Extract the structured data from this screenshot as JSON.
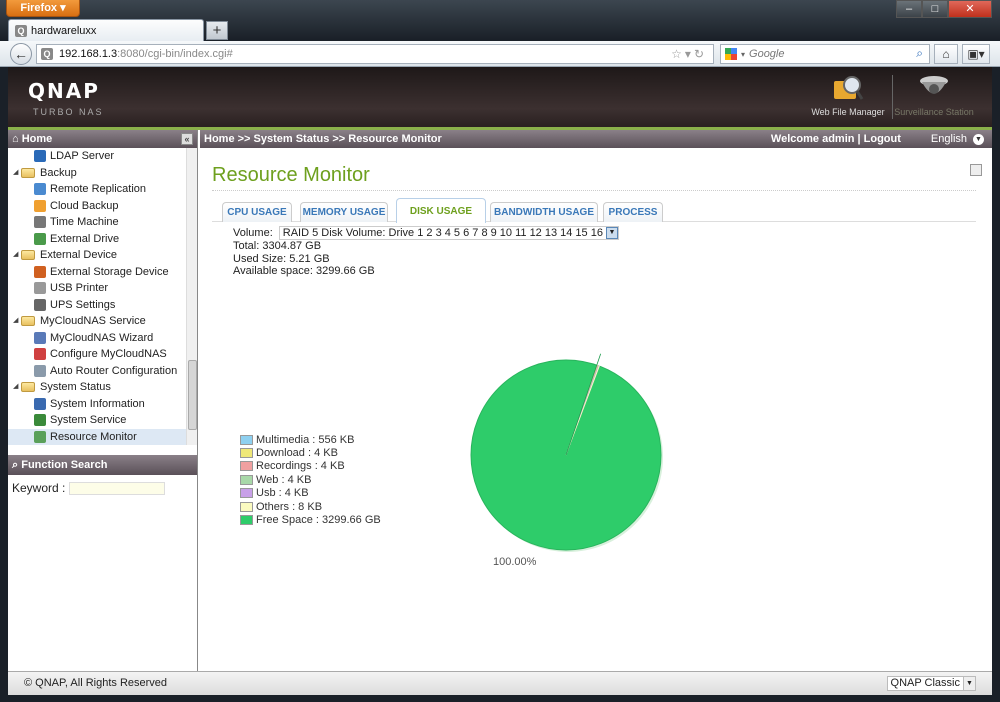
{
  "browser": {
    "app_button": "Firefox",
    "tab_title": "hardwareluxx",
    "new_tab": "+",
    "url_host": "192.168.1.3",
    "url_rest": ":8080/cgi-bin/index.cgi#",
    "search_placeholder": "Google",
    "window_controls": [
      "–",
      "□",
      "✕"
    ]
  },
  "header": {
    "logo": "QNAP",
    "subtitle": "TURBO NAS",
    "apps": [
      {
        "label": "Web File Manager",
        "icon": "folder-magnifier-icon"
      },
      {
        "label": "Surveillance Station",
        "icon": "camera-dome-icon"
      }
    ]
  },
  "sidebar": {
    "home_label": "Home",
    "tree": [
      {
        "type": "leaf",
        "label": "LDAP Server",
        "color": "#2a6ab8"
      },
      {
        "type": "folder",
        "label": "Backup"
      },
      {
        "type": "leaf",
        "label": "Remote Replication",
        "color": "#4a8ad0"
      },
      {
        "type": "leaf",
        "label": "Cloud Backup",
        "color": "#f0a030"
      },
      {
        "type": "leaf",
        "label": "Time Machine",
        "color": "#777777"
      },
      {
        "type": "leaf",
        "label": "External Drive",
        "color": "#4a9a4a"
      },
      {
        "type": "folder",
        "label": "External Device"
      },
      {
        "type": "leaf",
        "label": "External Storage Device",
        "color": "#d06020"
      },
      {
        "type": "leaf",
        "label": "USB Printer",
        "color": "#999999"
      },
      {
        "type": "leaf",
        "label": "UPS Settings",
        "color": "#666666"
      },
      {
        "type": "folder",
        "label": "MyCloudNAS Service"
      },
      {
        "type": "leaf",
        "label": "MyCloudNAS Wizard",
        "color": "#5a7ab8"
      },
      {
        "type": "leaf",
        "label": "Configure MyCloudNAS",
        "color": "#d04040"
      },
      {
        "type": "leaf",
        "label": "Auto Router Configuration",
        "color": "#8a9aaa"
      },
      {
        "type": "folder",
        "label": "System Status"
      },
      {
        "type": "leaf",
        "label": "System Information",
        "color": "#3a6ab0"
      },
      {
        "type": "leaf",
        "label": "System Service",
        "color": "#3a8a3a"
      },
      {
        "type": "leaf",
        "label": "Resource Monitor",
        "color": "#5aa05a",
        "selected": true
      }
    ],
    "function_search_label": "Function Search",
    "keyword_label": "Keyword :",
    "keyword_value": ""
  },
  "main": {
    "breadcrumb": "Home >> System Status >> Resource Monitor",
    "welcome": "Welcome admin | Logout",
    "language": "English",
    "title": "Resource Monitor",
    "tabs": [
      {
        "label": "CPU USAGE",
        "active": false
      },
      {
        "label": "MEMORY USAGE",
        "active": false
      },
      {
        "label": "DISK USAGE",
        "active": true
      },
      {
        "label": "BANDWIDTH USAGE",
        "active": false
      },
      {
        "label": "PROCESS",
        "active": false
      }
    ],
    "volume_label": "Volume:",
    "volume_value": "RAID 5 Disk Volume: Drive 1 2 3 4 5 6 7 8 9 10 11 12 13 14 15 16",
    "total": "Total: 3304.87 GB",
    "used": "Used Size: 5.21 GB",
    "available": "Available space: 3299.66 GB"
  },
  "chart_data": {
    "type": "pie",
    "title": "",
    "slices": [
      {
        "label": "Multimedia : 556 KB",
        "name": "Multimedia",
        "value_kb": 556,
        "color": "#8ed0f0"
      },
      {
        "label": "Download : 4 KB",
        "name": "Download",
        "value_kb": 4,
        "color": "#f0e878"
      },
      {
        "label": "Recordings : 4 KB",
        "name": "Recordings",
        "value_kb": 4,
        "color": "#f0a0a0"
      },
      {
        "label": "Web : 4 KB",
        "name": "Web",
        "value_kb": 4,
        "color": "#a8d8a8"
      },
      {
        "label": "Usb : 4 KB",
        "name": "Usb",
        "value_kb": 4,
        "color": "#c8a0e8"
      },
      {
        "label": "Others : 8 KB",
        "name": "Others",
        "value_kb": 8,
        "color": "#fafac0"
      },
      {
        "label": "Free Space : 3299.66 GB",
        "name": "Free Space",
        "value_kb": 3459900000,
        "color": "#2ecc6a"
      }
    ],
    "data_label": "100.00%",
    "legend_position": "bottom-left"
  },
  "footer": {
    "copyright": "© QNAP, All Rights Reserved",
    "theme": "QNAP Classic"
  }
}
